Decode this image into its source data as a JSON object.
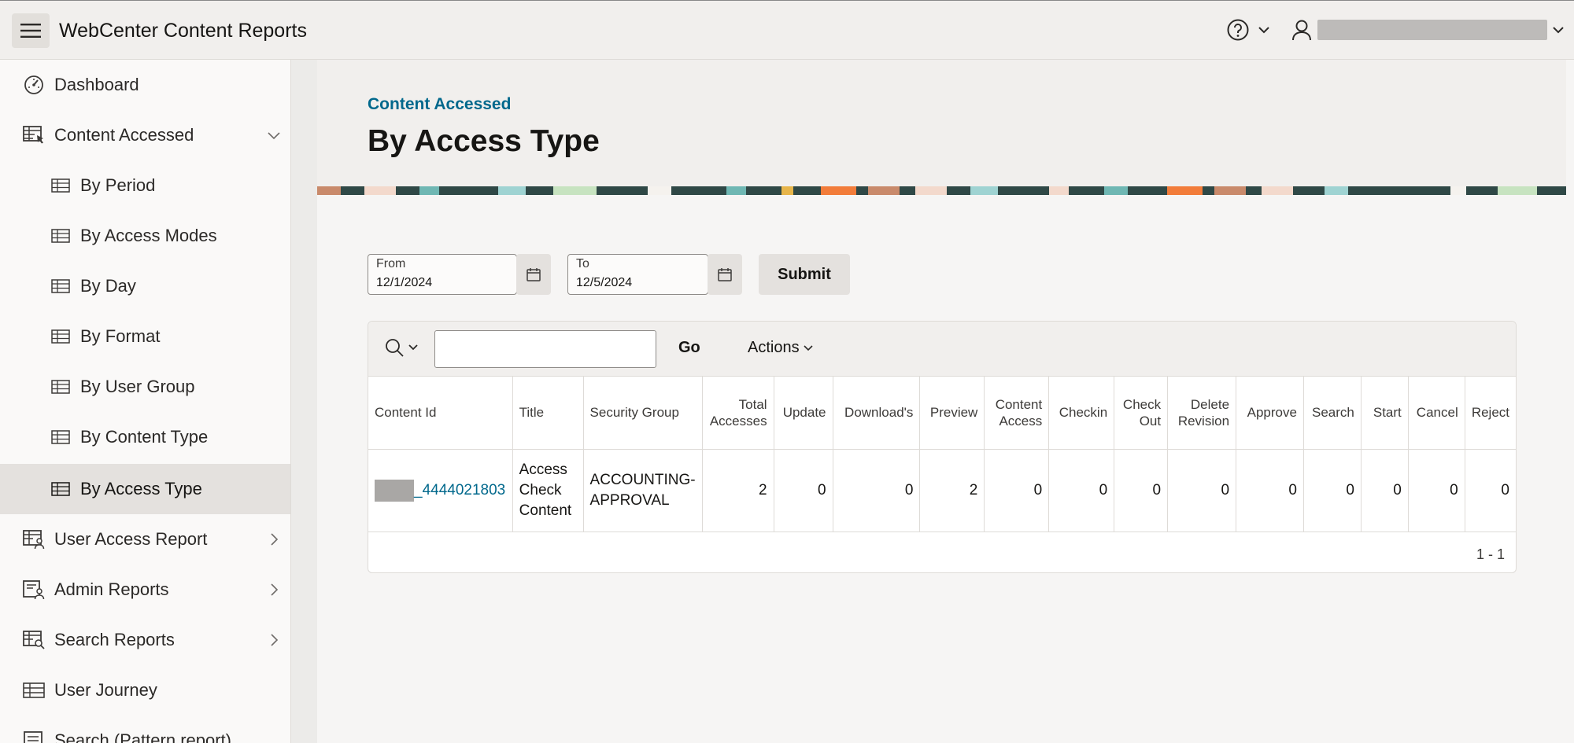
{
  "header": {
    "app_title": "WebCenter Content Reports",
    "menu_icon": "hamburger-icon",
    "help_icon": "help-circle-icon",
    "user_icon": "user-icon"
  },
  "sidebar": {
    "items": [
      {
        "label": "Dashboard",
        "icon": "gauge-icon"
      },
      {
        "label": "Content Accessed",
        "icon": "report-pointer-icon"
      },
      {
        "label": "By Period",
        "icon": "table-icon"
      },
      {
        "label": "By Access Modes",
        "icon": "table-icon"
      },
      {
        "label": "By Day",
        "icon": "table-icon"
      },
      {
        "label": "By Format",
        "icon": "table-icon"
      },
      {
        "label": "By User Group",
        "icon": "table-icon"
      },
      {
        "label": "By Content Type",
        "icon": "table-icon"
      },
      {
        "label": "By Access Type",
        "icon": "table-icon"
      },
      {
        "label": "User Access Report",
        "icon": "report-user-icon"
      },
      {
        "label": "Admin Reports",
        "icon": "report-user-icon"
      },
      {
        "label": "Search Reports",
        "icon": "report-search-icon"
      },
      {
        "label": "User Journey",
        "icon": "table-icon"
      },
      {
        "label": "Search (Pattern report)",
        "icon": "report-icon"
      }
    ]
  },
  "page": {
    "breadcrumb": "Content Accessed",
    "title": "By Access Type"
  },
  "filters": {
    "from_label": "From",
    "from_value": "12/1/2024",
    "to_label": "To",
    "to_value": "12/5/2024",
    "submit_label": "Submit"
  },
  "report": {
    "go_label": "Go",
    "actions_label": "Actions",
    "search_value": "",
    "columns": [
      "Content Id",
      "Title",
      "Security Group",
      "Total Accesses",
      "Update",
      "Download's",
      "Preview",
      "Content Access",
      "Checkin",
      "Check Out",
      "Delete Revision",
      "Approve",
      "Search",
      "Start",
      "Cancel",
      "Reject"
    ],
    "rows": [
      {
        "content_id_suffix": "_4444021803",
        "title": "Access Check Content",
        "security_group": "ACCOUNTING-APPROVAL",
        "total_accesses": "2",
        "update": "0",
        "downloads": "0",
        "preview": "2",
        "content_access": "0",
        "checkin": "0",
        "check_out": "0",
        "delete_revision": "0",
        "approve": "0",
        "search": "0",
        "start": "0",
        "cancel": "0",
        "reject": "0"
      }
    ],
    "pagination": "1 - 1"
  },
  "colors": {
    "accent": "#00688c",
    "active_nav": "#e4e1de"
  }
}
